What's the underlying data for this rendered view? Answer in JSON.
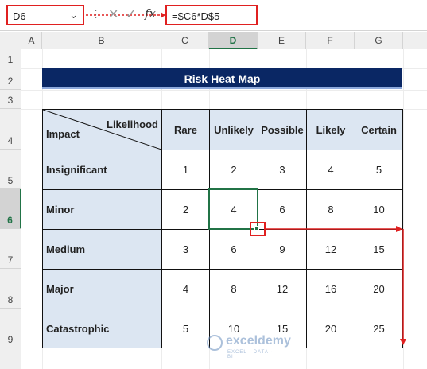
{
  "formula_bar": {
    "name_box": "D6",
    "dots": "⋮",
    "cancel": "✕",
    "enter": "✓",
    "fx": "fx",
    "formula": "=$C6*D$5"
  },
  "columns": [
    "A",
    "B",
    "C",
    "D",
    "E",
    "F",
    "G"
  ],
  "rows": [
    "1",
    "2",
    "3",
    "4",
    "5",
    "6",
    "7",
    "8",
    "9"
  ],
  "selected_column": "D",
  "selected_row": "6",
  "title": "Risk Heat Map",
  "table": {
    "corner_top": "Likelihood",
    "corner_bottom": "Impact",
    "likelihood": [
      "Rare",
      "Unlikely",
      "Possible",
      "Likely",
      "Certain"
    ],
    "rows": [
      {
        "label": "Insignificant",
        "values": [
          "1",
          "2",
          "3",
          "4",
          "5"
        ]
      },
      {
        "label": "Minor",
        "values": [
          "2",
          "4",
          "6",
          "8",
          "10"
        ]
      },
      {
        "label": "Medium",
        "values": [
          "3",
          "6",
          "9",
          "12",
          "15"
        ]
      },
      {
        "label": "Major",
        "values": [
          "4",
          "8",
          "12",
          "16",
          "20"
        ]
      },
      {
        "label": "Catastrophic",
        "values": [
          "5",
          "10",
          "15",
          "20",
          "25"
        ]
      }
    ]
  },
  "watermark": {
    "name": "exceldemy",
    "tagline": "EXCEL · DATA · BI"
  },
  "colors": {
    "title_bg": "#0a2764",
    "header_bg": "#dce6f2",
    "selection": "#217346",
    "annotation": "#e02020"
  }
}
